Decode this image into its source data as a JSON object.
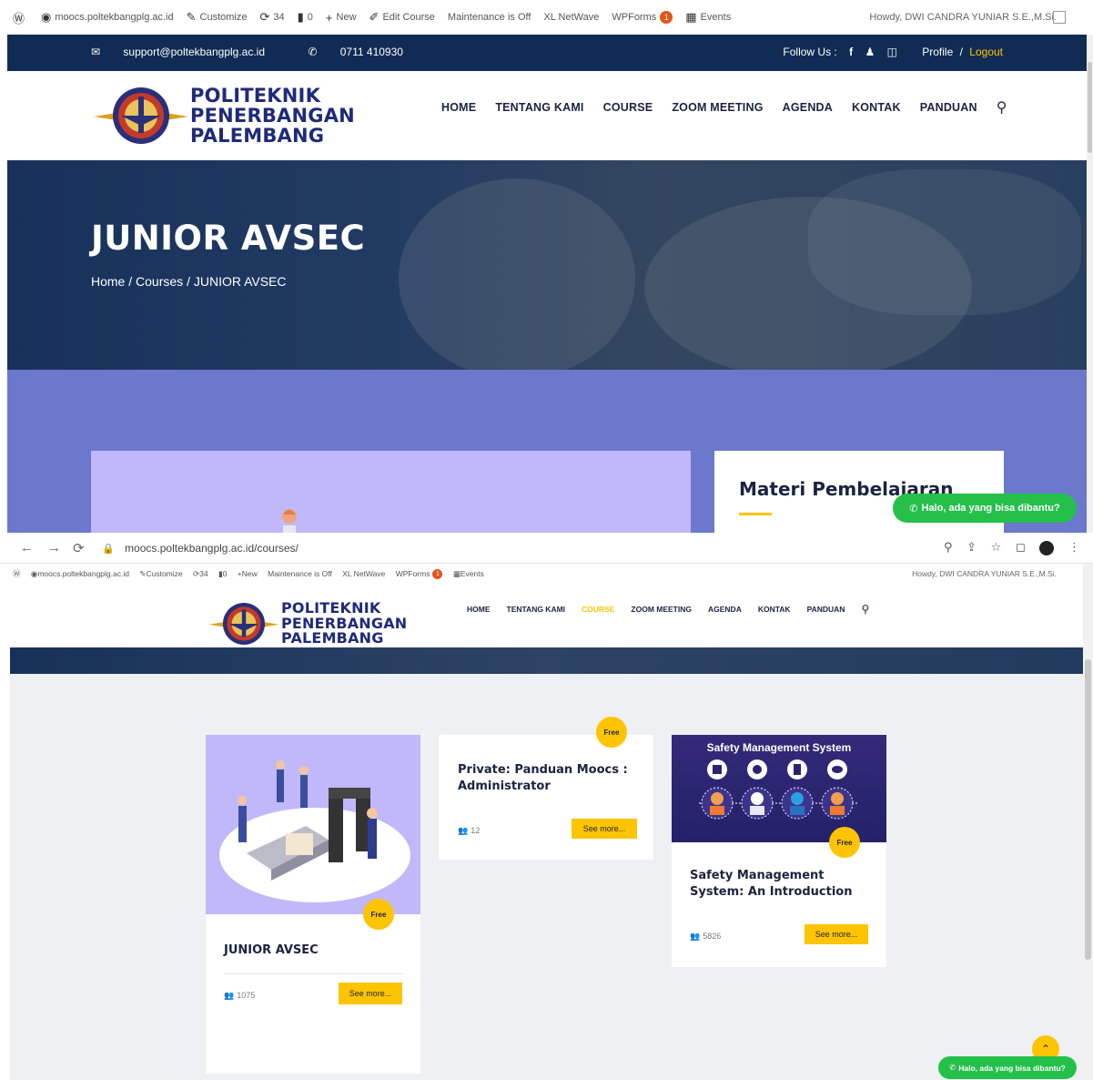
{
  "top": {
    "wp_admin_bar": {
      "site": "moocs.poltekbangplg.ac.id",
      "customize": "Customize",
      "updates": "34",
      "comments": "0",
      "new": "New",
      "edit": "Edit Course",
      "maintenance": "Maintenance is Off",
      "xlnet": "XL NetWave",
      "wpforms": "WPForms",
      "wpforms_badge": "1",
      "events": "Events",
      "howdy": "Howdy, DWI CANDRA YUNIAR S.E.,M.Si."
    },
    "info_bar": {
      "email": "support@poltekbangplg.ac.id",
      "phone": "0711 410930",
      "follow": "Follow Us :",
      "profile": "Profile",
      "separator": "/",
      "logout": "Logout"
    },
    "logo": {
      "line1": "POLITEKNIK",
      "line2": "PENERBANGAN",
      "line3": "PALEMBANG"
    },
    "nav": [
      "HOME",
      "TENTANG KAMI",
      "COURSE",
      "ZOOM MEETING",
      "AGENDA",
      "KONTAK",
      "PANDUAN"
    ],
    "hero": {
      "title": "JUNIOR AVSEC",
      "breadcrumb": [
        "Home",
        "Courses",
        "JUNIOR AVSEC"
      ],
      "sep": "/"
    },
    "materi_title": "Materi Pembelajaran",
    "whatsapp": "Halo, ada yang bisa dibantu?"
  },
  "bottom": {
    "browser": {
      "url": "moocs.poltekbangplg.ac.id/courses/"
    },
    "wp_admin_bar": {
      "site": "moocs.poltekbangplg.ac.id",
      "customize": "Customize",
      "updates": "34",
      "comments": "0",
      "new": "New",
      "maintenance": "Maintenance is Off",
      "xlnet": "XL NetWave",
      "wpforms": "WPForms",
      "wpforms_badge": "1",
      "events": "Events",
      "howdy": "Howdy, DWI CANDRA YUNIAR S.E.,M.Si."
    },
    "logo": {
      "line1": "POLITEKNIK",
      "line2": "PENERBANGAN",
      "line3": "PALEMBANG"
    },
    "nav": [
      "HOME",
      "TENTANG KAMI",
      "COURSE",
      "ZOOM MEETING",
      "AGENDA",
      "KONTAK",
      "PANDUAN"
    ],
    "courses": [
      {
        "title": "JUNIOR AVSEC",
        "badge": "Free",
        "count": "1075",
        "button": "See more..."
      },
      {
        "title": "Private: Panduan Moocs : Administrator",
        "badge": "Free",
        "count": "12",
        "button": "See more..."
      },
      {
        "title": "Safety Management System: An Introduction",
        "badge": "Free",
        "count": "5826",
        "button": "See more...",
        "image_title": "Safety Management System"
      }
    ],
    "whatsapp": "Halo, ada yang bisa dibantu?"
  },
  "colors": {
    "navy": "#102c54",
    "accent": "#ffc400",
    "band": "#6b78cc",
    "lavender": "#c0b8fb",
    "whatsapp": "#24c04a",
    "brand_text": "#1f2a7a"
  }
}
